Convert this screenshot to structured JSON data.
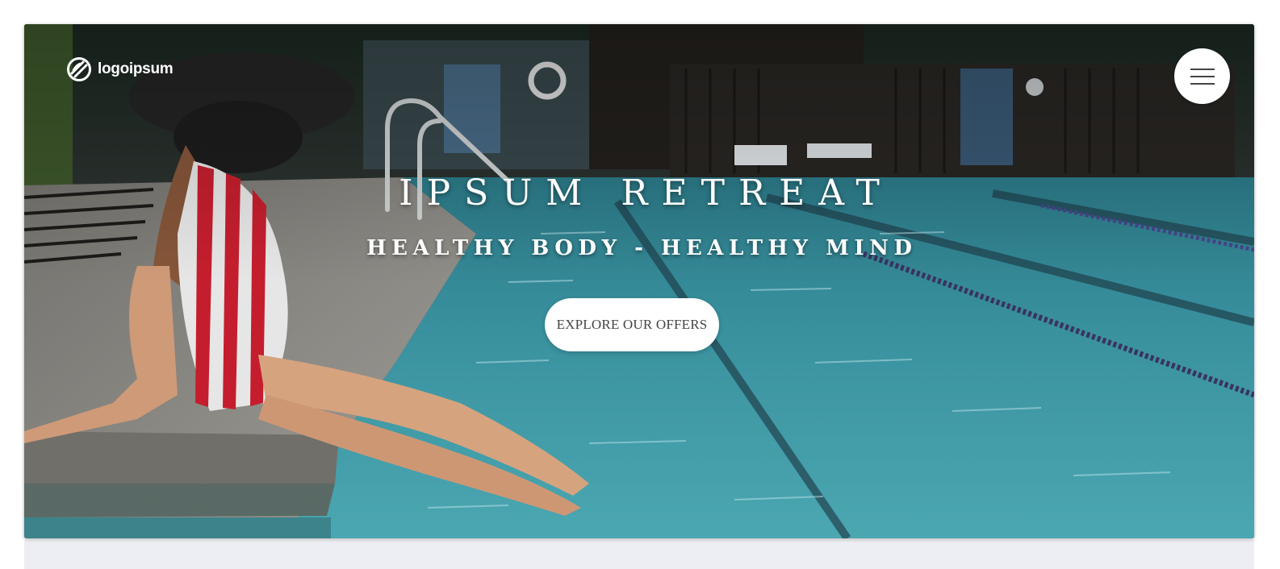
{
  "header": {
    "brand_name": "logoipsum",
    "brand_icon": "logoipsum-icon",
    "menu_icon": "hamburger-menu-icon"
  },
  "hero": {
    "title": "IPSUM RETREAT",
    "subtitle": "HEALTHY BODY - HEALTHY MIND",
    "cta_label": "EXPLORE OUR OFFERS",
    "background_image": "pool-photo",
    "colors": {
      "pool_water": "#3d9aa8",
      "deck": "#9c9a95",
      "text": "#ffffff",
      "button_bg": "#ffffff",
      "button_text": "#444444"
    }
  },
  "page": {
    "below_section_color": "#eceef3"
  }
}
